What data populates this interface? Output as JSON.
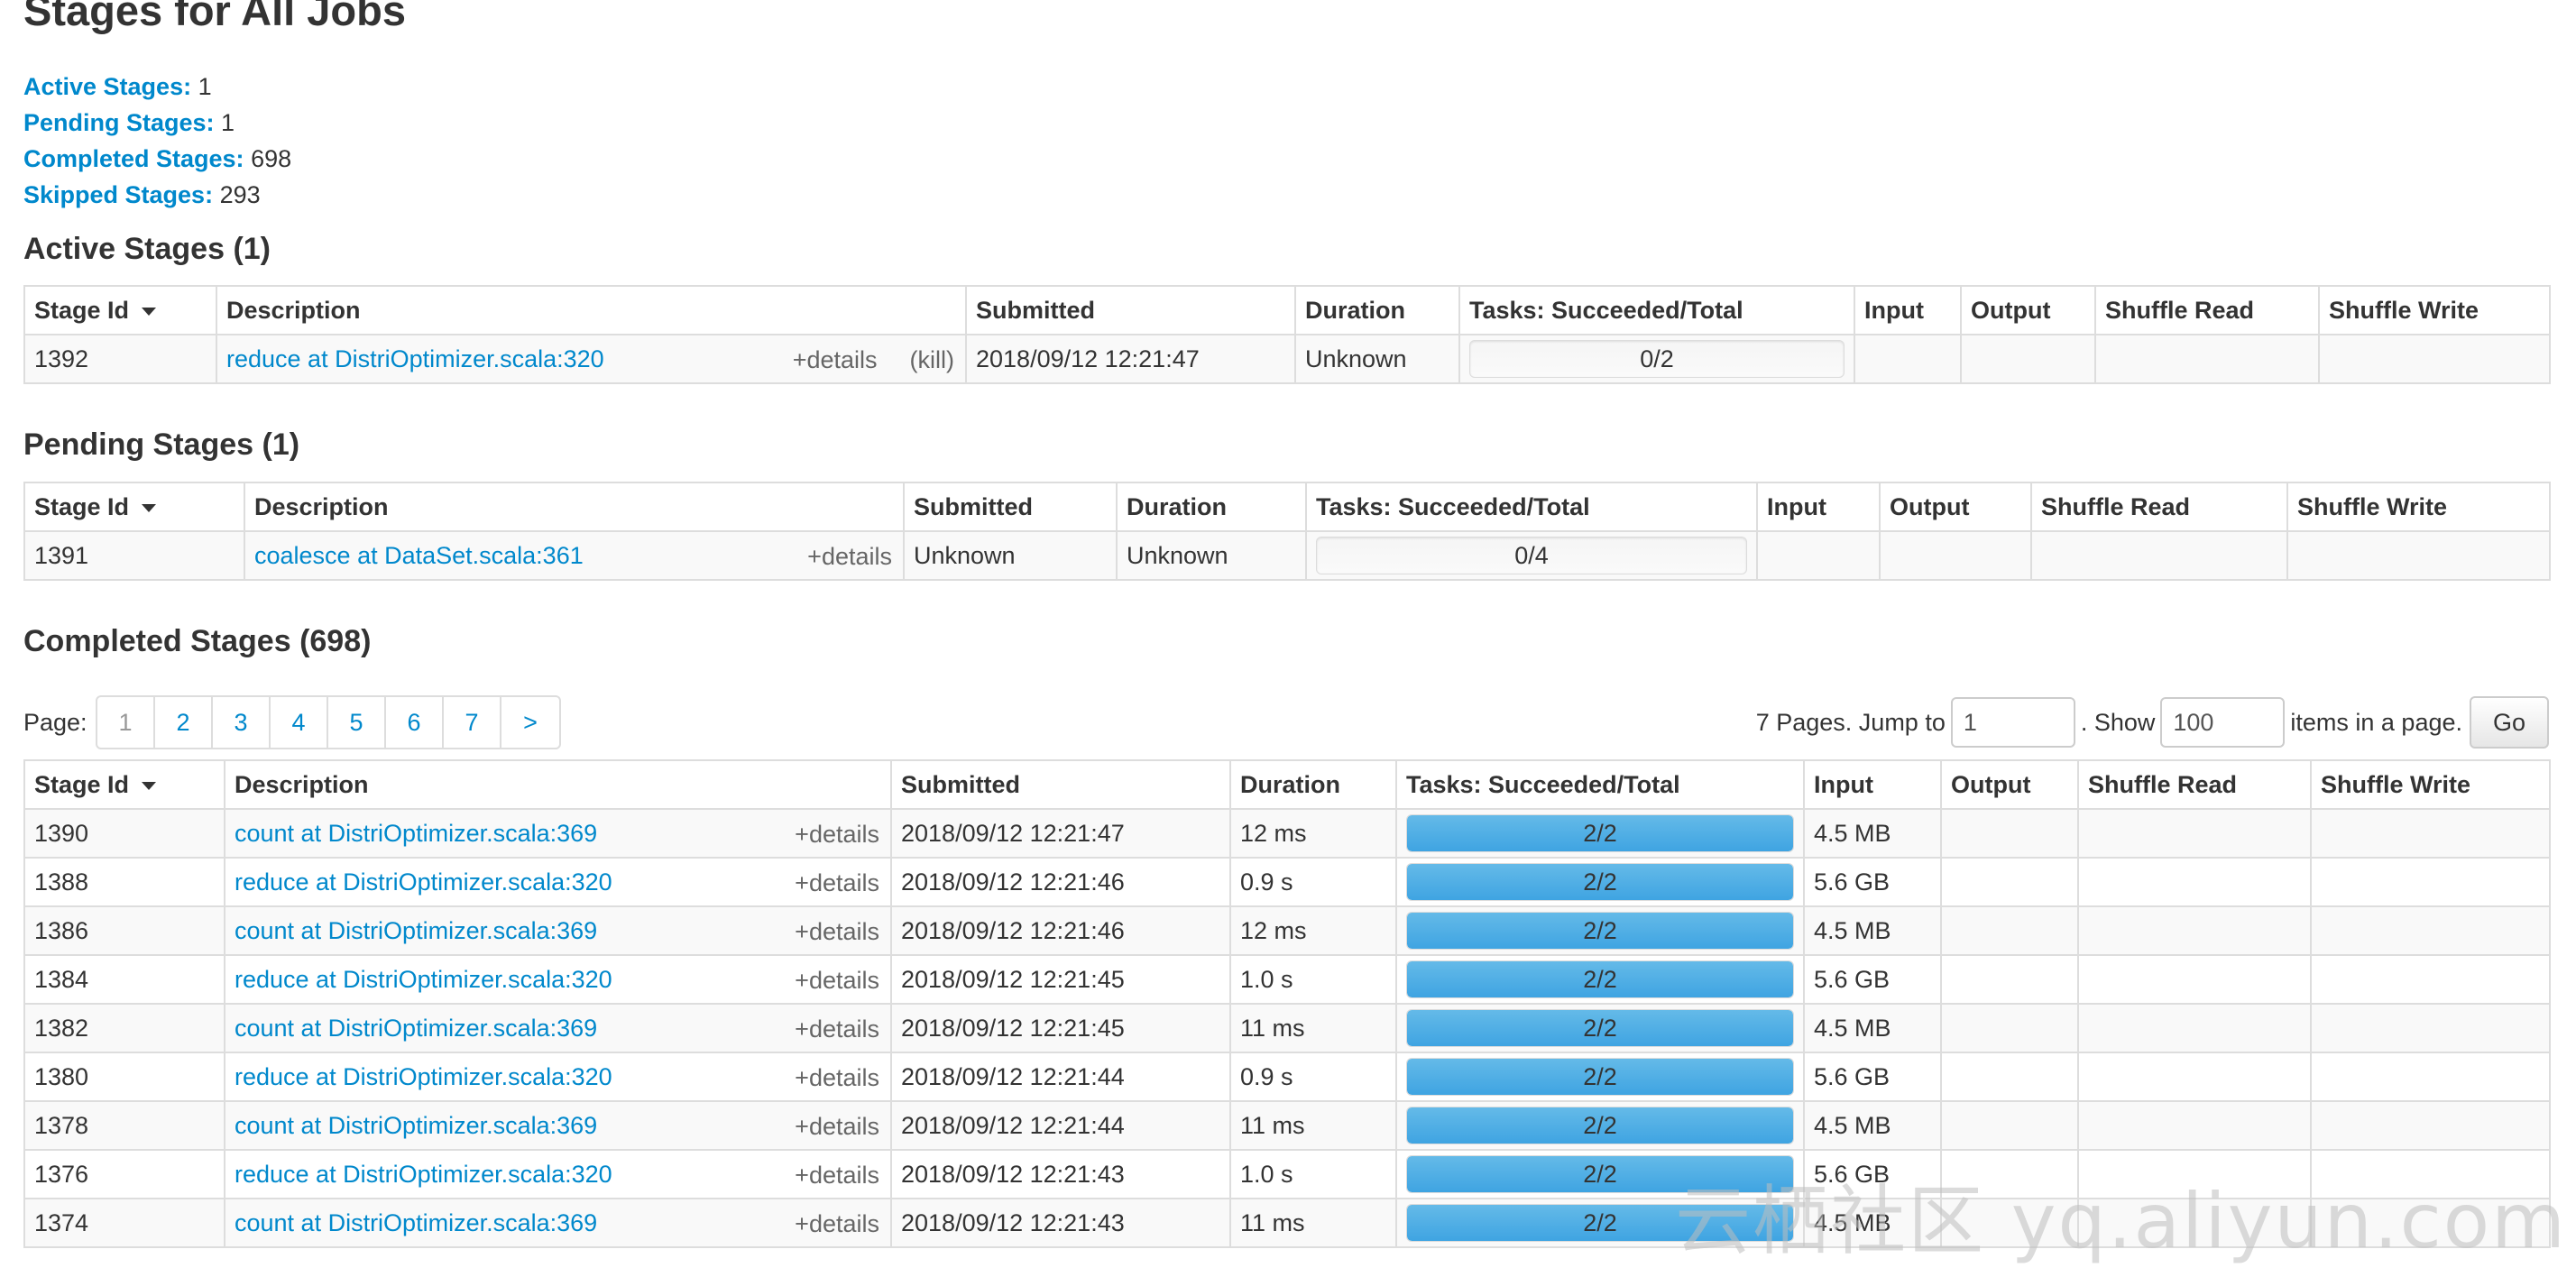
{
  "title": "Stages for All Jobs",
  "summary": [
    {
      "label": "Active Stages:",
      "value": "1"
    },
    {
      "label": "Pending Stages:",
      "value": "1"
    },
    {
      "label": "Completed Stages:",
      "value": "698"
    },
    {
      "label": "Skipped Stages:",
      "value": "293"
    }
  ],
  "columns": {
    "stage_id": "Stage Id",
    "description": "Description",
    "submitted": "Submitted",
    "duration": "Duration",
    "tasks": "Tasks: Succeeded/Total",
    "input": "Input",
    "output": "Output",
    "shuffle_read": "Shuffle Read",
    "shuffle_write": "Shuffle Write"
  },
  "details_label": "+details",
  "kill_label": "(kill)",
  "active": {
    "heading": "Active Stages (1)",
    "rows": [
      {
        "id": "1392",
        "desc": "reduce at DistriOptimizer.scala:320",
        "submitted": "2018/09/12 12:21:47",
        "duration": "Unknown",
        "tasks": "0/2",
        "progress": 0,
        "input": "",
        "output": "",
        "shuffle_read": "",
        "shuffle_write": ""
      }
    ]
  },
  "pending": {
    "heading": "Pending Stages (1)",
    "rows": [
      {
        "id": "1391",
        "desc": "coalesce at DataSet.scala:361",
        "submitted": "Unknown",
        "duration": "Unknown",
        "tasks": "0/4",
        "progress": 0,
        "input": "",
        "output": "",
        "shuffle_read": "",
        "shuffle_write": ""
      }
    ]
  },
  "completed": {
    "heading": "Completed Stages (698)",
    "pagination": {
      "page_label": "Page:",
      "pages": [
        "1",
        "2",
        "3",
        "4",
        "5",
        "6",
        "7",
        ">"
      ],
      "current": "1",
      "total_text": "7 Pages. Jump to",
      "jump_value": "1",
      "show_text": ". Show",
      "show_value": "100",
      "items_text": "items in a page.",
      "go_label": "Go"
    },
    "rows": [
      {
        "id": "1390",
        "desc": "count at DistriOptimizer.scala:369",
        "submitted": "2018/09/12 12:21:47",
        "duration": "12 ms",
        "tasks": "2/2",
        "progress": 1,
        "input": "4.5 MB",
        "output": "",
        "shuffle_read": "",
        "shuffle_write": ""
      },
      {
        "id": "1388",
        "desc": "reduce at DistriOptimizer.scala:320",
        "submitted": "2018/09/12 12:21:46",
        "duration": "0.9 s",
        "tasks": "2/2",
        "progress": 1,
        "input": "5.6 GB",
        "output": "",
        "shuffle_read": "",
        "shuffle_write": ""
      },
      {
        "id": "1386",
        "desc": "count at DistriOptimizer.scala:369",
        "submitted": "2018/09/12 12:21:46",
        "duration": "12 ms",
        "tasks": "2/2",
        "progress": 1,
        "input": "4.5 MB",
        "output": "",
        "shuffle_read": "",
        "shuffle_write": ""
      },
      {
        "id": "1384",
        "desc": "reduce at DistriOptimizer.scala:320",
        "submitted": "2018/09/12 12:21:45",
        "duration": "1.0 s",
        "tasks": "2/2",
        "progress": 1,
        "input": "5.6 GB",
        "output": "",
        "shuffle_read": "",
        "shuffle_write": ""
      },
      {
        "id": "1382",
        "desc": "count at DistriOptimizer.scala:369",
        "submitted": "2018/09/12 12:21:45",
        "duration": "11 ms",
        "tasks": "2/2",
        "progress": 1,
        "input": "4.5 MB",
        "output": "",
        "shuffle_read": "",
        "shuffle_write": ""
      },
      {
        "id": "1380",
        "desc": "reduce at DistriOptimizer.scala:320",
        "submitted": "2018/09/12 12:21:44",
        "duration": "0.9 s",
        "tasks": "2/2",
        "progress": 1,
        "input": "5.6 GB",
        "output": "",
        "shuffle_read": "",
        "shuffle_write": ""
      },
      {
        "id": "1378",
        "desc": "count at DistriOptimizer.scala:369",
        "submitted": "2018/09/12 12:21:44",
        "duration": "11 ms",
        "tasks": "2/2",
        "progress": 1,
        "input": "4.5 MB",
        "output": "",
        "shuffle_read": "",
        "shuffle_write": ""
      },
      {
        "id": "1376",
        "desc": "reduce at DistriOptimizer.scala:320",
        "submitted": "2018/09/12 12:21:43",
        "duration": "1.0 s",
        "tasks": "2/2",
        "progress": 1,
        "input": "5.6 GB",
        "output": "",
        "shuffle_read": "",
        "shuffle_write": ""
      },
      {
        "id": "1374",
        "desc": "count at DistriOptimizer.scala:369",
        "submitted": "2018/09/12 12:21:43",
        "duration": "11 ms",
        "tasks": "2/2",
        "progress": 1,
        "input": "4.5 MB",
        "output": "",
        "shuffle_read": "",
        "shuffle_write": ""
      }
    ]
  },
  "watermark": "云栖社区 yq.aliyun.com",
  "colors": {
    "link": "#0088cc",
    "progress_fill": "#4aabe5",
    "border": "#dddddd"
  }
}
